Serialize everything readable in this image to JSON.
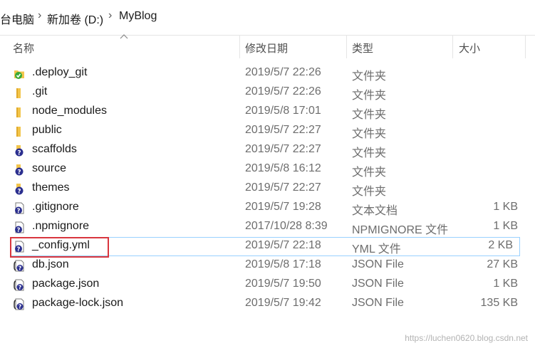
{
  "breadcrumb": {
    "items": [
      "台电脑",
      "新加卷 (D:)",
      "MyBlog"
    ],
    "separator": "›"
  },
  "columns": {
    "name": "名称",
    "modified": "修改日期",
    "type": "类型",
    "size": "大小"
  },
  "files": [
    {
      "name": ".deploy_git",
      "modified": "2019/5/7 22:26",
      "type": "文件夹",
      "size": "",
      "icon": "folder-sync-icon"
    },
    {
      "name": ".git",
      "modified": "2019/5/7 22:26",
      "type": "文件夹",
      "size": "",
      "icon": "folder-icon"
    },
    {
      "name": "node_modules",
      "modified": "2019/5/8 17:01",
      "type": "文件夹",
      "size": "",
      "icon": "folder-icon"
    },
    {
      "name": "public",
      "modified": "2019/5/7 22:27",
      "type": "文件夹",
      "size": "",
      "icon": "folder-icon"
    },
    {
      "name": "scaffolds",
      "modified": "2019/5/7 22:27",
      "type": "文件夹",
      "size": "",
      "icon": "folder-unknown-icon"
    },
    {
      "name": "source",
      "modified": "2019/5/8 16:12",
      "type": "文件夹",
      "size": "",
      "icon": "folder-unknown-icon"
    },
    {
      "name": "themes",
      "modified": "2019/5/7 22:27",
      "type": "文件夹",
      "size": "",
      "icon": "folder-unknown-icon"
    },
    {
      "name": ".gitignore",
      "modified": "2019/5/7 19:28",
      "type": "文本文档",
      "size": "1 KB",
      "icon": "file-unknown-icon"
    },
    {
      "name": ".npmignore",
      "modified": "2017/10/28 8:39",
      "type": "NPMIGNORE 文件",
      "size": "1 KB",
      "icon": "file-unknown-icon"
    },
    {
      "name": "_config.yml",
      "modified": "2019/5/7 22:18",
      "type": "YML 文件",
      "size": "2 KB",
      "icon": "file-unknown-icon",
      "selected": true
    },
    {
      "name": "db.json",
      "modified": "2019/5/8 17:18",
      "type": "JSON File",
      "size": "27 KB",
      "icon": "json-file-icon"
    },
    {
      "name": "package.json",
      "modified": "2019/5/7 19:50",
      "type": "JSON File",
      "size": "1 KB",
      "icon": "json-file-icon"
    },
    {
      "name": "package-lock.json",
      "modified": "2019/5/7 19:42",
      "type": "JSON File",
      "size": "135 KB",
      "icon": "json-file-icon"
    }
  ],
  "watermark": "https://luchen0620.blog.csdn.net",
  "colors": {
    "folder": "#f3c54b",
    "folder_dark": "#e0a92a",
    "unknown_badge": "#2b2f8f",
    "sync_badge": "#3aaa35",
    "selection_border": "#99d1ff",
    "highlight_red": "#d9363e"
  }
}
